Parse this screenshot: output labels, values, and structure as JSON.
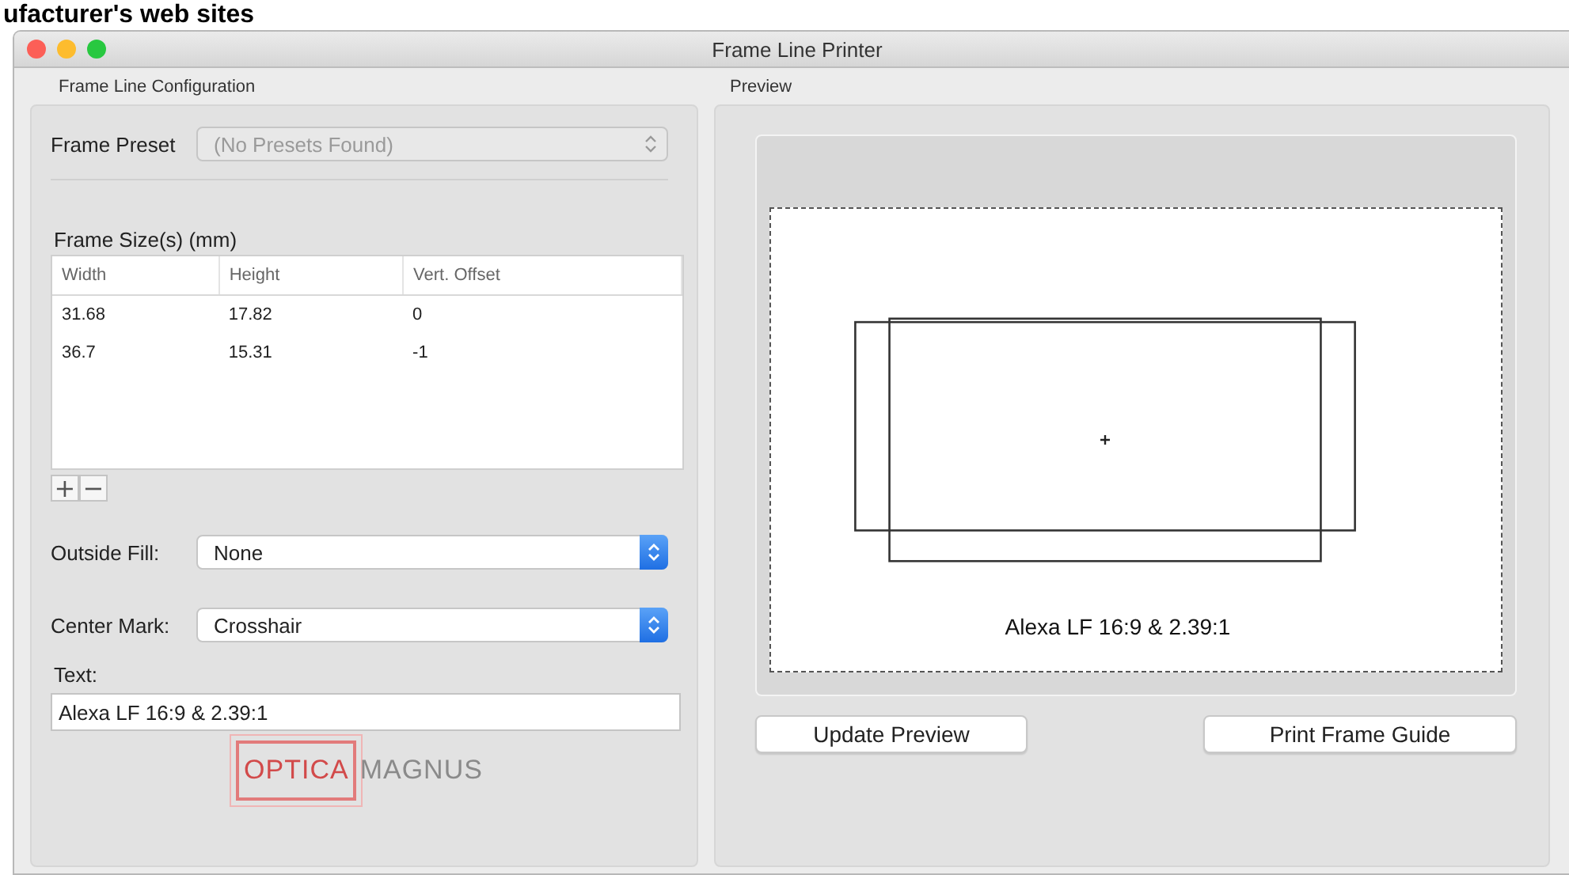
{
  "page_caption": "ufacturer's web sites",
  "window": {
    "title": "Frame Line Printer"
  },
  "config": {
    "heading": "Frame Line Configuration",
    "frame_preset": {
      "label": "Frame Preset",
      "value": "(No Presets Found)",
      "disabled": true
    },
    "frame_sizes": {
      "label": "Frame Size(s) (mm)",
      "columns": [
        "Width",
        "Height",
        "Vert. Offset"
      ],
      "rows": [
        [
          "31.68",
          "17.82",
          "0"
        ],
        [
          "36.7",
          "15.31",
          "-1"
        ]
      ],
      "add_button": "+",
      "remove_button": "−"
    },
    "outside_fill": {
      "label": "Outside Fill:",
      "value": "None",
      "disabled": false
    },
    "center_mark": {
      "label": "Center Mark:",
      "value": "Crosshair",
      "disabled": false
    },
    "text": {
      "label": "Text:",
      "value": "Alexa LF 16:9 & 2.39:1"
    },
    "logo": {
      "boxed": "OPTICA",
      "plain": "MAGNUS"
    }
  },
  "preview": {
    "heading": "Preview",
    "caption": "Alexa LF 16:9 & 2.39:1",
    "buttons": [
      "Update Preview",
      "Print Frame Guide"
    ]
  }
}
